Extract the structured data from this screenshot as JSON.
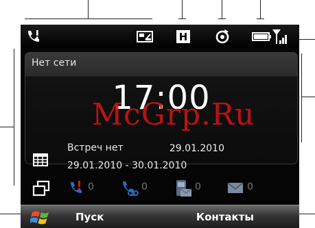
{
  "status_bar": {
    "icons": [
      "missed-call-icon",
      "data-icon",
      "hsdpa-icon",
      "sync-icon",
      "battery-icon",
      "signal-icon"
    ],
    "hsdpa_label": "H"
  },
  "home": {
    "network_text": "Нет сети",
    "time": "17:00",
    "date": "29.01.2010",
    "appointment_title": "Встреч нет",
    "appointment_range": "29.01.2010 - 30.01.2010",
    "counters": [
      {
        "icon": "missed-call-icon",
        "value": "0"
      },
      {
        "icon": "voicemail-icon",
        "value": "0"
      },
      {
        "icon": "sms-icon",
        "value": "0"
      },
      {
        "icon": "email-icon",
        "value": "0"
      }
    ]
  },
  "softkeys": {
    "left": "Пуск",
    "right": "Контакты"
  },
  "watermark": "McGrp.Ru"
}
